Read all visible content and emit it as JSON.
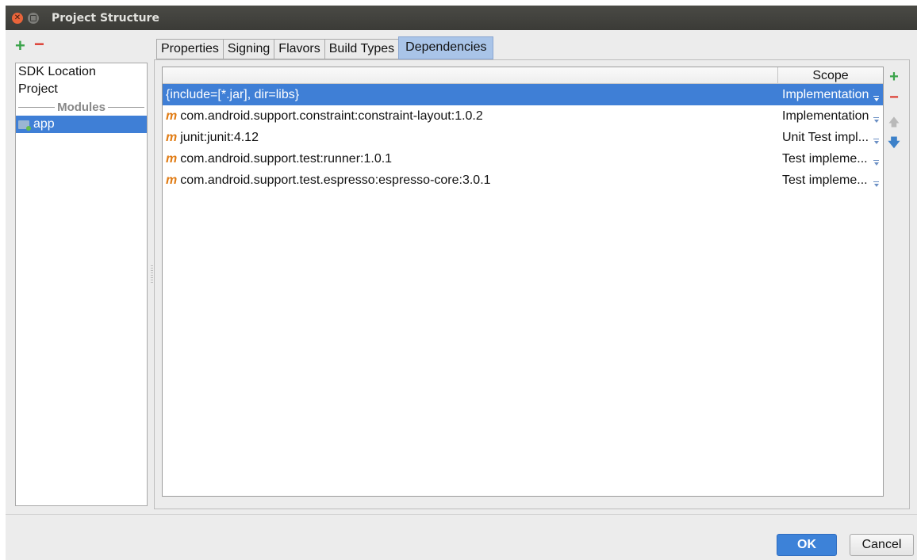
{
  "window": {
    "title": "Project Structure"
  },
  "left": {
    "add_icon": "plus-icon",
    "remove_icon": "minus-icon",
    "items": [
      "SDK Location",
      "Project"
    ],
    "modules_header": "Modules",
    "modules": [
      "app"
    ]
  },
  "tabs": [
    "Properties",
    "Signing",
    "Flavors",
    "Build Types",
    "Dependencies"
  ],
  "active_tab": "Dependencies",
  "table": {
    "columns": [
      "",
      "Scope"
    ],
    "rows": [
      {
        "name": "{include=[*.jar], dir=libs}",
        "maven": false,
        "scope": "Implementation"
      },
      {
        "name": "com.android.support.constraint:constraint-layout:1.0.2",
        "maven": true,
        "scope": "Implementation"
      },
      {
        "name": "junit:junit:4.12",
        "maven": true,
        "scope": "Unit Test impl..."
      },
      {
        "name": "com.android.support.test:runner:1.0.1",
        "maven": true,
        "scope": "Test impleme..."
      },
      {
        "name": "com.android.support.test.espresso:espresso-core:3.0.1",
        "maven": true,
        "scope": "Test impleme..."
      }
    ],
    "maven_icon_text": "m"
  },
  "buttons": {
    "ok": "OK",
    "cancel": "Cancel"
  },
  "colors": {
    "selection": "#3f7fd6",
    "accent_ok": "#3d82d8",
    "add_green": "#3aa34a",
    "remove_red": "#dc3c31",
    "maven_orange": "#e07b13"
  }
}
